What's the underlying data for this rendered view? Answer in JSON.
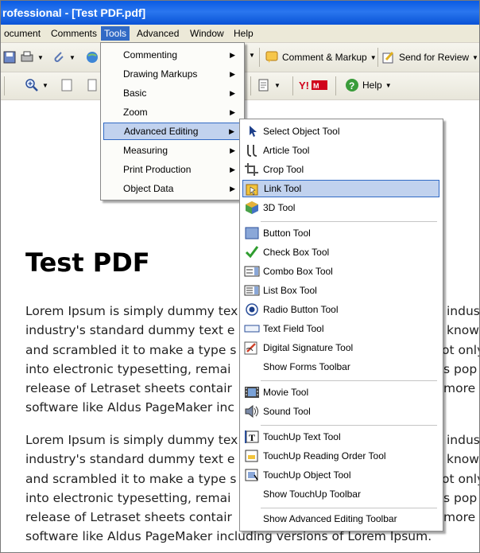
{
  "window": {
    "title": "rofessional - [Test PDF.pdf]"
  },
  "menubar": [
    "ocument",
    "Comments",
    "Tools",
    "Advanced",
    "Window",
    "Help"
  ],
  "toolbar": {
    "comment_markup": "Comment & Markup",
    "send_review": "Send for Review",
    "help": "Help"
  },
  "tools_menu": [
    "Commenting",
    "Drawing Markups",
    "Basic",
    "Zoom",
    "Advanced Editing",
    "Measuring",
    "Print Production",
    "Object Data"
  ],
  "advanced_editing_menu": [
    "Select Object Tool",
    "Article Tool",
    "Crop Tool",
    "Link Tool",
    "3D Tool",
    "Button Tool",
    "Check Box Tool",
    "Combo Box Tool",
    "List Box Tool",
    "Radio Button Tool",
    "Text Field Tool",
    "Digital Signature Tool",
    "Show Forms Toolbar",
    "Movie Tool",
    "Sound Tool",
    "TouchUp Text Tool",
    "TouchUp Reading Order Tool",
    "TouchUp Object Tool",
    "Show TouchUp Toolbar",
    "Show Advanced Editing Toolbar"
  ],
  "document": {
    "heading": "Test PDF",
    "para1": [
      "Lorem Ipsum is simply dummy tex",
      "industry's standard dummy text e",
      "and scrambled it to make a type s",
      "into electronic typesetting, remai",
      "release of Letraset sheets contair",
      "software like Aldus PageMaker inc"
    ],
    "para1_right": [
      "indus",
      "know",
      "ot only",
      "s pop",
      "more",
      ""
    ],
    "para2": [
      "Lorem Ipsum is simply dummy tex",
      "industry's standard dummy text e",
      "and scrambled it to make a type s",
      "into electronic typesetting, remai",
      "release of Letraset sheets contair",
      "software like Aldus PageMaker including versions of Lorem Ipsum."
    ],
    "para2_right": [
      "indus",
      "know",
      "ot only",
      "s pop",
      "more",
      ""
    ]
  }
}
